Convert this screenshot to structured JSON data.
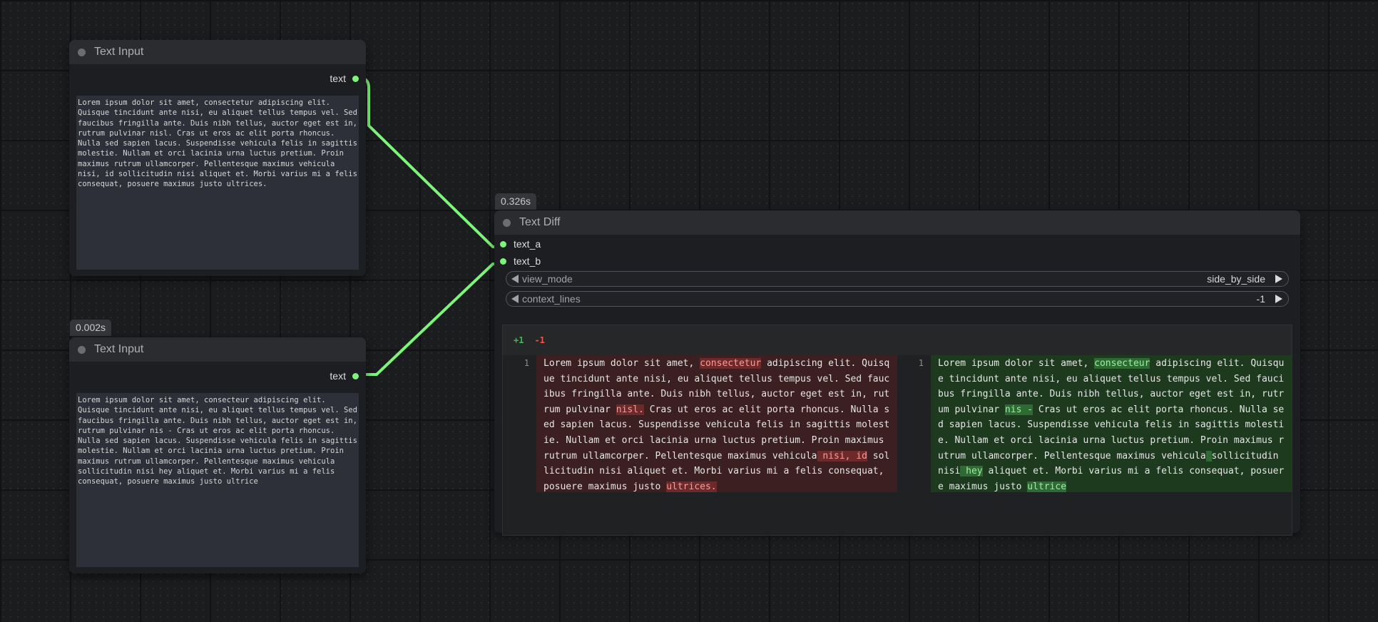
{
  "nodes": {
    "input1": {
      "title": "Text Input",
      "output_label": "text",
      "value": "Lorem ipsum dolor sit amet, consectetur adipiscing elit. Quisque tincidunt ante nisi, eu aliquet tellus tempus vel. Sed faucibus fringilla ante. Duis nibh tellus, auctor eget est in, rutrum pulvinar nisl. Cras ut eros ac elit porta rhoncus. Nulla sed sapien lacus. Suspendisse vehicula felis in sagittis molestie. Nullam et orci lacinia urna luctus pretium. Proin maximus rutrum ullamcorper. Pellentesque maximus vehicula nisi, id sollicitudin nisi aliquet et. Morbi varius mi a felis consequat, posuere maximus justo ultrices."
    },
    "input2": {
      "timing": "0.002s",
      "title": "Text Input",
      "output_label": "text",
      "value": "Lorem ipsum dolor sit amet, consecteur adipiscing elit. Quisque tincidunt ante nisi, eu aliquet tellus tempus vel. Sed faucibus fringilla ante. Duis nibh tellus, auctor eget est in, rutrum pulvinar nis - Cras ut eros ac elit porta rhoncus. Nulla sed sapien lacus. Suspendisse vehicula felis in sagittis molestie. Nullam et orci lacinia urna luctus pretium. Proin maximus rutrum ullamcorper. Pellentesque maximus vehicula  sollicitudin nisi hey aliquet et. Morbi varius mi a felis consequat, posuere maximus justo ultrice"
    },
    "diff": {
      "timing": "0.326s",
      "title": "Text Diff",
      "inputs": [
        "text_a",
        "text_b"
      ],
      "widgets": [
        {
          "label": "view_mode",
          "value": "side_by_side"
        },
        {
          "label": "context_lines",
          "value": "-1"
        }
      ],
      "stats": {
        "added": "+1",
        "removed": "-1"
      },
      "left": {
        "line_number": "1",
        "segments": [
          {
            "t": "Lorem ipsum dolor sit amet, ",
            "h": false
          },
          {
            "t": "consectetur",
            "h": true
          },
          {
            "t": " adipiscing elit. Quisque tincidunt ante nisi, eu aliquet tellus tempus vel. Sed faucibus fringilla ante. Duis nibh tellus, auctor eget est in, rutrum pulvinar ",
            "h": false
          },
          {
            "t": "nisl.",
            "h": true
          },
          {
            "t": " Cras ut eros ac elit porta rhoncus. Nulla sed sapien lacus. Suspendisse vehicula felis in sagittis molestie. Nullam et orci lacinia urna luctus pretium. Proin maximus rutrum ullamcorper. Pellentesque maximus vehicula",
            "h": false
          },
          {
            "t": " nisi, id",
            "h": true
          },
          {
            "t": " sollicitudin nisi aliquet et. Morbi varius mi a felis consequat, posuere maximus justo ",
            "h": false
          },
          {
            "t": "ultrices.",
            "h": true
          }
        ]
      },
      "right": {
        "line_number": "1",
        "segments": [
          {
            "t": "Lorem ipsum dolor sit amet, ",
            "h": false
          },
          {
            "t": "consecteur",
            "h": true
          },
          {
            "t": " adipiscing elit. Quisque tincidunt ante nisi, eu aliquet tellus tempus vel. Sed faucibus fringilla ante. Duis nibh tellus, auctor eget est in, rutrum pulvinar ",
            "h": false
          },
          {
            "t": "nis -",
            "h": true
          },
          {
            "t": " Cras ut eros ac elit porta rhoncus. Nulla sed sapien lacus. Suspendisse vehicula felis in sagittis molestie. Nullam et orci lacinia urna luctus pretium. Proin maximus rutrum ullamcorper. Pellentesque maximus vehicula",
            "h": false
          },
          {
            "t": "  ",
            "h": true
          },
          {
            "t": "sollicitudin nisi",
            "h": false
          },
          {
            "t": " hey",
            "h": true
          },
          {
            "t": " aliquet et. Morbi varius mi a felis consequat, posuere maximus justo ",
            "h": false
          },
          {
            "t": "ultrice",
            "h": true
          }
        ]
      }
    }
  },
  "colors": {
    "link": "#7cf57a",
    "added_bg": "#1d3a1f",
    "removed_bg": "#3c1f20"
  }
}
